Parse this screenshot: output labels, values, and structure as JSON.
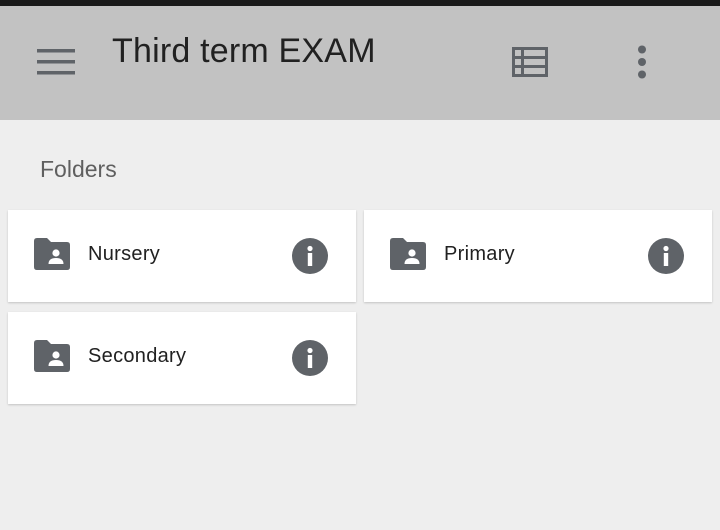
{
  "app_bar": {
    "title": "Third term EXAM",
    "menu_icon": "hamburger-menu-icon",
    "list_view_icon": "list-view-icon",
    "more_icon": "more-vert-icon",
    "background": "#c2c2c2"
  },
  "section": {
    "header": "Folders"
  },
  "folders": [
    {
      "name": "Nursery",
      "icon": "shared-folder-icon",
      "info_icon": "info-icon"
    },
    {
      "name": "Primary",
      "icon": "shared-folder-icon",
      "info_icon": "info-icon"
    },
    {
      "name": "Secondary",
      "icon": "shared-folder-icon",
      "info_icon": "info-icon"
    }
  ],
  "colors": {
    "background": "#eeeeee",
    "card": "#ffffff",
    "icon": "#5f6368",
    "text": "#212121"
  }
}
